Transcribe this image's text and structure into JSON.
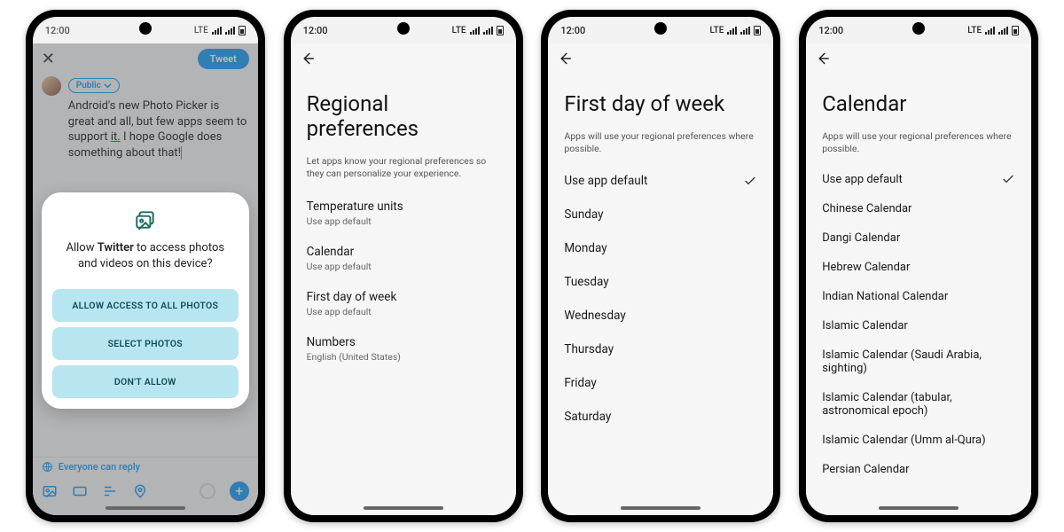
{
  "status": {
    "time": "12:00",
    "net": "LTE"
  },
  "phone1": {
    "close": "✕",
    "tweet_btn": "Tweet",
    "audience": "Public",
    "compose_text_before": "Android's new Photo Picker is great and all, but few apps seem to support ",
    "compose_text_underlined": "it.",
    "compose_text_after": " I hope Google does something about that!",
    "reply_row": "Everyone can reply",
    "dialog": {
      "title_before": "Allow ",
      "title_app": "Twitter",
      "title_after": " to access photos and videos on this device?",
      "btn_all": "ALLOW ACCESS TO ALL PHOTOS",
      "btn_select": "SELECT PHOTOS",
      "btn_deny": "DON'T ALLOW"
    }
  },
  "phone2": {
    "title": "Regional preferences",
    "subtitle": "Let apps know your regional preferences so they can personalize your experience.",
    "items": [
      {
        "label": "Temperature units",
        "sub": "Use app default"
      },
      {
        "label": "Calendar",
        "sub": "Use app default"
      },
      {
        "label": "First day of week",
        "sub": "Use app default"
      },
      {
        "label": "Numbers",
        "sub": "English (United States)"
      }
    ]
  },
  "phone3": {
    "title": "First day of week",
    "subtitle": "Apps will use your regional preferences where possible.",
    "options": [
      "Use app default",
      "Sunday",
      "Monday",
      "Tuesday",
      "Wednesday",
      "Thursday",
      "Friday",
      "Saturday"
    ],
    "selected_index": 0
  },
  "phone4": {
    "title": "Calendar",
    "subtitle": "Apps will use your regional preferences where possible.",
    "options": [
      "Use app default",
      "Chinese Calendar",
      "Dangi Calendar",
      "Hebrew Calendar",
      "Indian National Calendar",
      "Islamic Calendar",
      "Islamic Calendar (Saudi Arabia, sighting)",
      "Islamic Calendar (tabular, astronomical epoch)",
      "Islamic Calendar (Umm al-Qura)",
      "Persian Calendar"
    ],
    "selected_index": 0
  }
}
